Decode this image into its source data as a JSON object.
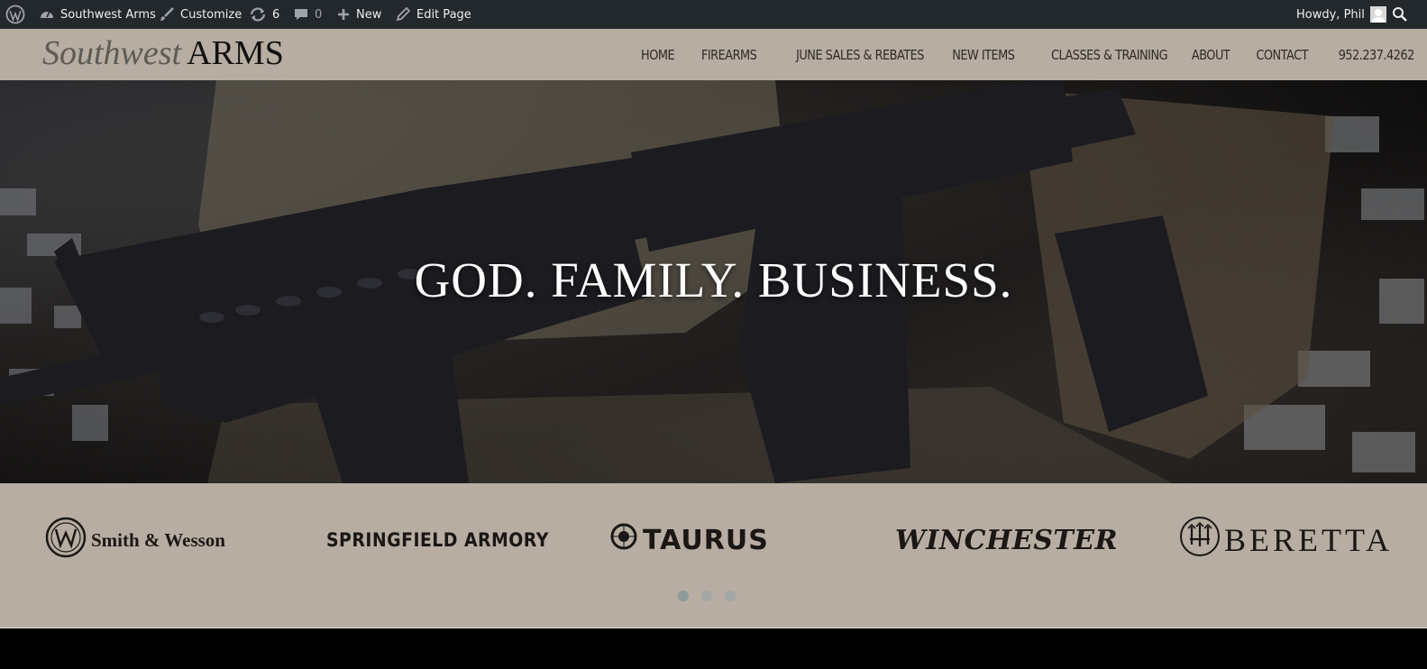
{
  "admin_bar": {
    "site_name": "Southwest Arms",
    "customize": "Customize",
    "updates_count": "6",
    "comments_count": "0",
    "new_label": "New",
    "edit_page": "Edit Page",
    "howdy": "Howdy, Phil"
  },
  "header": {
    "logo_part1": "Southwest",
    "logo_part2": "ARMS",
    "nav": [
      "HOME",
      "FIREARMS",
      "JUNE SALES & REBATES",
      "NEW ITEMS",
      "CLASSES & TRAINING",
      "ABOUT",
      "CONTACT",
      "952.237.4262"
    ]
  },
  "hero": {
    "headline": "GOD. FAMILY. BUSINESS."
  },
  "brands": {
    "items": [
      "Smith & Wesson",
      "SPRINGFIELD ARMORY",
      "TAURUS",
      "WINCHESTER",
      "BERETTA"
    ],
    "carousel_dots": 3,
    "active_dot": 1
  }
}
